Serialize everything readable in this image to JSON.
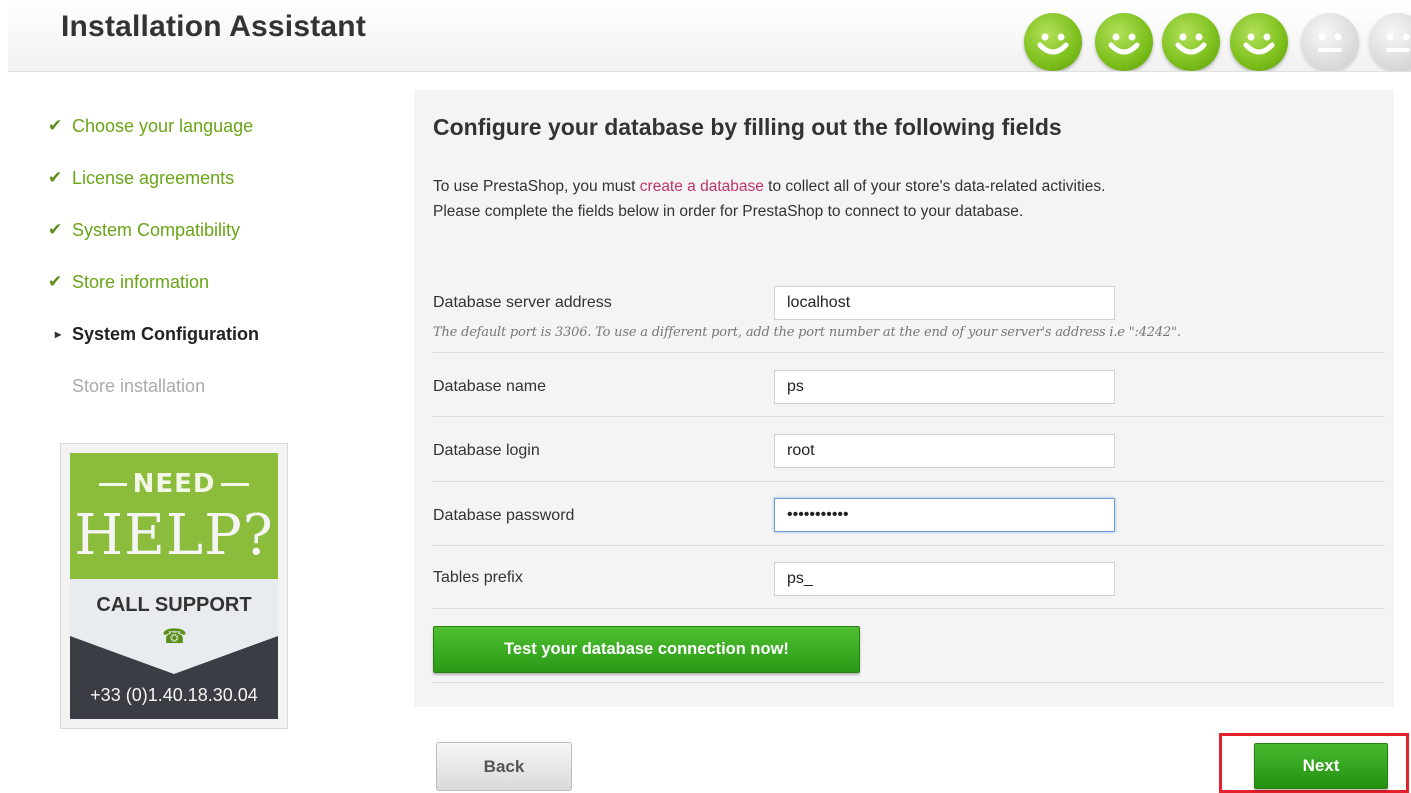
{
  "header": {
    "title": "Installation Assistant",
    "progress": {
      "completed_steps": 4,
      "total_steps_visible": 6
    },
    "colors": {
      "done": "#7cbf1b",
      "pending": "#dcdcdc"
    }
  },
  "steps": [
    {
      "label": "Choose your language",
      "state": "done",
      "mark": "✔"
    },
    {
      "label": "License agreements",
      "state": "done",
      "mark": "✔"
    },
    {
      "label": "System Compatibility",
      "state": "done",
      "mark": "✔"
    },
    {
      "label": "Store information",
      "state": "done",
      "mark": "✔"
    },
    {
      "label": "System Configuration",
      "state": "current",
      "mark": "▸"
    },
    {
      "label": "Store installation",
      "state": "todo",
      "mark": ""
    }
  ],
  "help": {
    "need": "NEED",
    "help": "HELP?",
    "call": "CALL SUPPORT",
    "phone": "+33 (0)1.40.18.30.04",
    "phone_icon": "telephone-icon"
  },
  "form": {
    "title": "Configure your database by filling out the following fields",
    "intro_prefix": "To use PrestaShop, you must ",
    "intro_link": "create a database",
    "intro_suffix": " to collect all of your store's data-related activities.",
    "intro_line2": "Please complete the fields below in order for PrestaShop to connect to your database.",
    "fields": {
      "server": {
        "label": "Database server address",
        "value": "localhost",
        "hint": "The default port is 3306. To use a different port, add the port number at the end of your server's address i.e \":4242\"."
      },
      "name": {
        "label": "Database name",
        "value": "ps"
      },
      "login": {
        "label": "Database login",
        "value": "root"
      },
      "password": {
        "label": "Database password",
        "value": "•••••••••••"
      },
      "prefix": {
        "label": "Tables prefix",
        "value": "ps_"
      }
    },
    "test_button": "Test your database connection now!"
  },
  "nav": {
    "back": "Back",
    "next": "Next"
  },
  "accent": {
    "link": "#c0346a",
    "green": "#4fbf31",
    "highlight": "#e4202a"
  }
}
